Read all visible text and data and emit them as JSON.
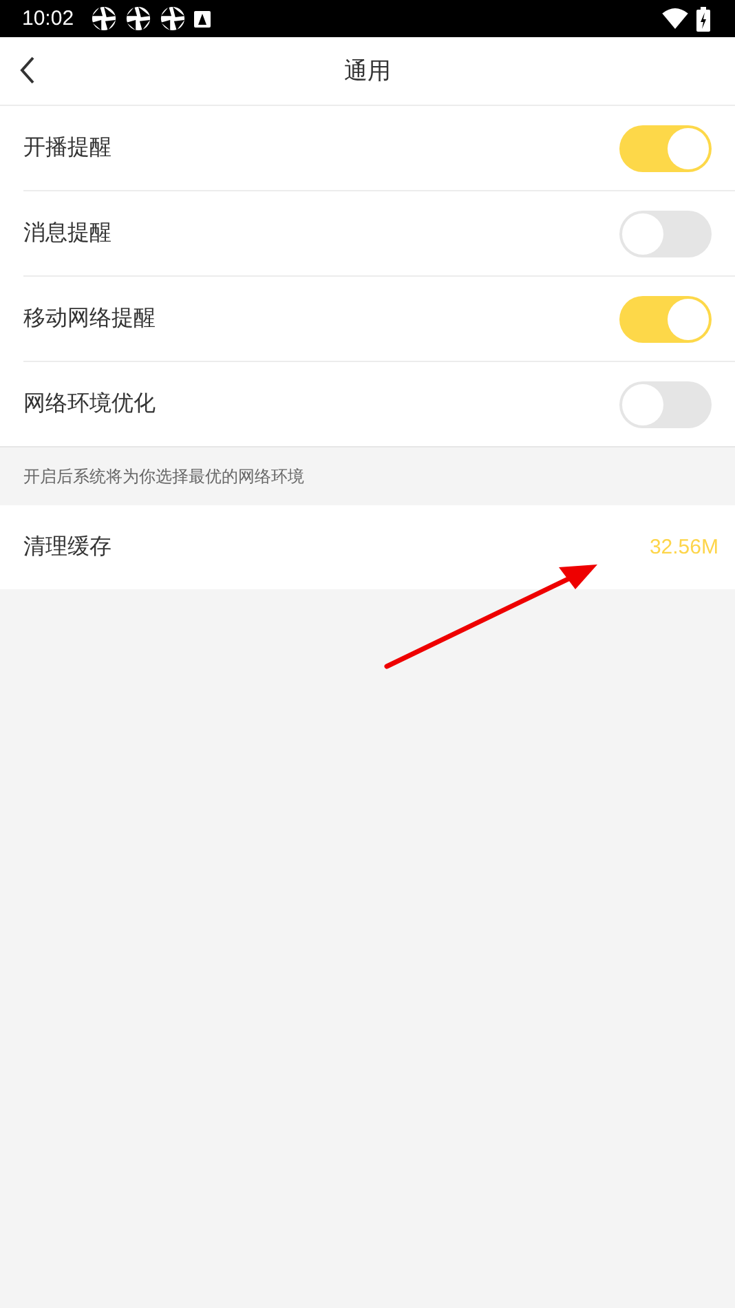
{
  "status_bar": {
    "time": "10:02"
  },
  "header": {
    "title": "通用"
  },
  "settings": [
    {
      "label": "开播提醒",
      "on": true
    },
    {
      "label": "消息提醒",
      "on": false
    },
    {
      "label": "移动网络提醒",
      "on": true
    },
    {
      "label": "网络环境优化",
      "on": false
    }
  ],
  "hint": "开启后系统将为你选择最优的网络环境",
  "cache": {
    "label": "清理缓存",
    "value": "32.56M"
  }
}
